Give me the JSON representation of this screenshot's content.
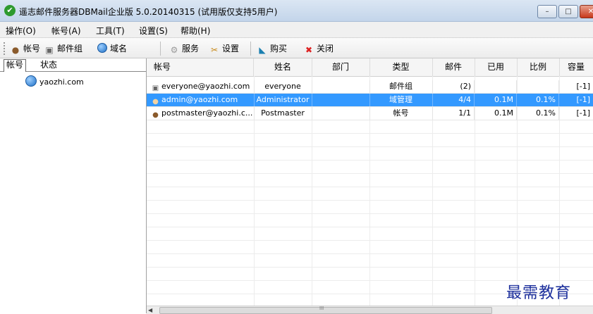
{
  "window": {
    "title": "遥志邮件服务器DBMail企业版 5.0.20140315 (试用版仅支持5用户)",
    "controls": {
      "minimize": "–",
      "maximize": "□",
      "close": "✕"
    }
  },
  "menu": [
    "操作(O)",
    "帐号(A)",
    "工具(T)",
    "设置(S)",
    "帮助(H)"
  ],
  "toolbar": {
    "items": [
      {
        "label": "帐号",
        "icon": "user-icon"
      },
      {
        "label": "邮件组",
        "icon": "mail-group-icon"
      },
      {
        "label": "域名",
        "icon": "globe-icon"
      },
      {
        "label": "服务",
        "icon": "gear-icon"
      },
      {
        "label": "设置",
        "icon": "tools-icon"
      },
      {
        "label": "购买",
        "icon": "cart-icon"
      },
      {
        "label": "关闭",
        "icon": "close-icon"
      }
    ]
  },
  "left_panel": {
    "tabs": [
      "帐号",
      "状态"
    ],
    "tree": [
      {
        "label": "yaozhi.com",
        "icon": "globe-icon"
      }
    ]
  },
  "grid": {
    "columns": [
      "帐号",
      "姓名",
      "部门",
      "类型",
      "邮件",
      "已用",
      "比例",
      "容量"
    ],
    "rows": [
      {
        "account": "everyone@yaozhi.com",
        "name": "everyone",
        "dept": "",
        "type": "邮件组",
        "mail": "(2)",
        "used": "",
        "ratio": "",
        "capacity": "[-1]",
        "icon": "mail-group-icon",
        "selected": false
      },
      {
        "account": "admin@yaozhi.com",
        "name": "Administrator",
        "dept": "",
        "type": "域管理",
        "mail": "4/4",
        "used": "0.1M",
        "ratio": "0.1%",
        "capacity": "[-1]",
        "icon": "user-icon",
        "selected": true
      },
      {
        "account": "postmaster@yaozhi.c...",
        "name": "Postmaster",
        "dept": "",
        "type": "帐号",
        "mail": "1/1",
        "used": "0.1M",
        "ratio": "0.1%",
        "capacity": "[-1]",
        "icon": "user-icon",
        "selected": false
      }
    ],
    "scroll_indicator": "III"
  },
  "watermark": "最需教育",
  "colors": {
    "selection": "#3399ff",
    "title_bar": "#c3d5ea",
    "close_button": "#c7381b",
    "watermark": "#1c2f9c"
  }
}
